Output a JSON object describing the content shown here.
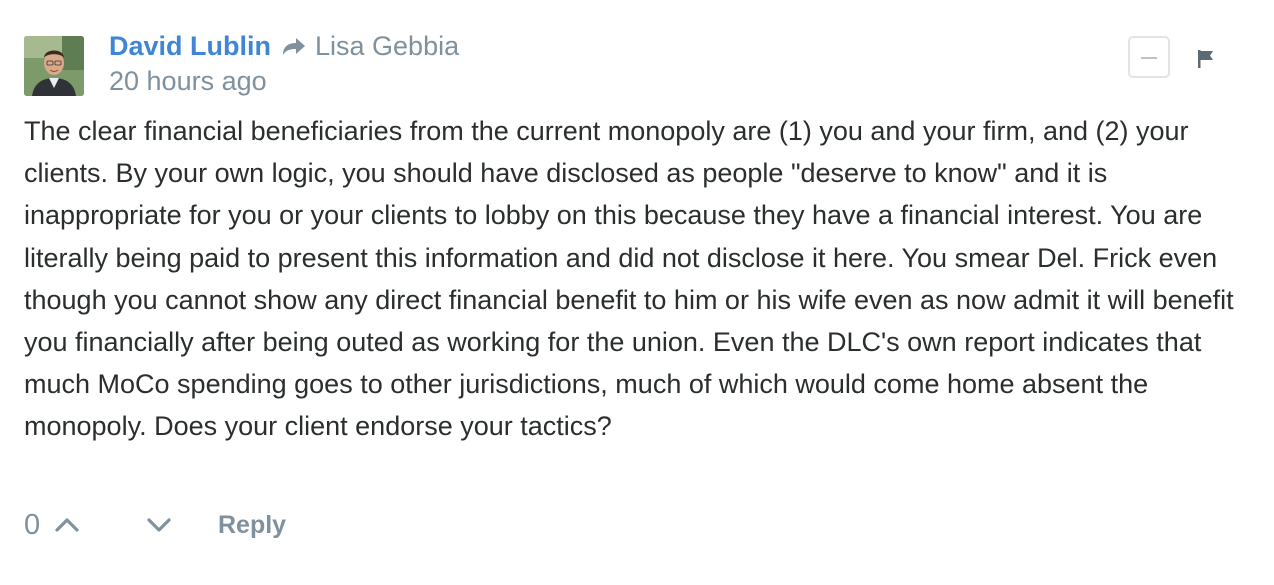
{
  "comment": {
    "author": "David Lublin",
    "in_reply_to": "Lisa Gebbia",
    "timestamp": "20 hours ago",
    "body": "The clear financial beneficiaries from the current monopoly are (1) you and your firm, and (2) your clients. By your own logic, you should have disclosed as people \"deserve to know\" and it is inappropriate for you or your clients to lobby on this because they have a financial interest. You are literally being paid to present this information and did not disclose it here. You smear Del. Frick even though you cannot show any direct financial benefit to him or his wife even as now admit it will benefit you financially after being outed as working for the union. Even the DLC's own report indicates that much MoCo spending goes to other jurisdictions, much of which would come home absent the monopoly. Does your client endorse your tactics?",
    "vote_count": "0",
    "reply_label": "Reply"
  },
  "icons": {
    "avatar": "avatar-photo",
    "reply_arrow": "reply-arrow-icon",
    "collapse": "minus-icon",
    "flag": "flag-icon",
    "upvote": "chevron-up-icon",
    "downvote": "chevron-down-icon"
  },
  "colors": {
    "author": "#3f86d6",
    "muted": "#7f919e",
    "text": "#2a2e2e",
    "border": "#dfe4e7"
  }
}
